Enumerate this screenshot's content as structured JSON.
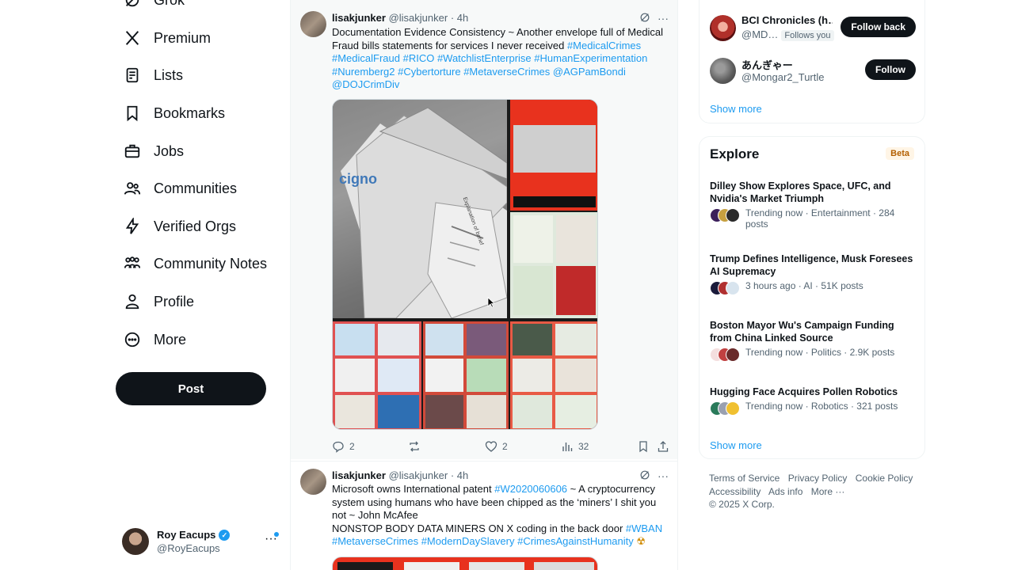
{
  "nav": {
    "items": [
      {
        "label": "Grok",
        "icon": "grok-icon"
      },
      {
        "label": "Premium",
        "icon": "x-logo-icon"
      },
      {
        "label": "Lists",
        "icon": "lists-icon"
      },
      {
        "label": "Bookmarks",
        "icon": "bookmark-icon"
      },
      {
        "label": "Jobs",
        "icon": "briefcase-icon"
      },
      {
        "label": "Communities",
        "icon": "people-icon"
      },
      {
        "label": "Verified Orgs",
        "icon": "lightning-icon"
      },
      {
        "label": "Community Notes",
        "icon": "community-notes-icon"
      },
      {
        "label": "Profile",
        "icon": "person-icon"
      },
      {
        "label": "More",
        "icon": "more-circle-icon"
      }
    ],
    "post_label": "Post"
  },
  "account": {
    "name": "Roy Eacups",
    "handle": "@RoyEacups",
    "more": "···"
  },
  "tweets": [
    {
      "name": "lisakjunker",
      "handle": "@lisakjunker",
      "time": "· 4h",
      "text_plain": "Documentation Evidence Consistency ~ Another envelope full of Medical Fraud bills statements for services I never received ",
      "text_links": "#MedicalCrimes #MedicalFraud #RICO #WatchlistEnterprise #HumanExperimentation #Nuremberg2 #Cybertorture #MetaverseCrimes @AGPamBondi @DOJCrimDiv",
      "replies": "2",
      "reposts": "",
      "likes": "2",
      "views": "32"
    },
    {
      "name": "lisakjunker",
      "handle": "@lisakjunker",
      "time": "· 4h",
      "line1_plain": "Microsoft owns International patent ",
      "line1_link": "#W2020060606",
      "line1_rest": "  ~ A cryptocurrency system using humans who have been chipped as the ‘miners’ I shit you not ~ John McAfee",
      "line2_plain": "NONSTOP BODY DATA MINERS ON  X coding in the back door  ",
      "line2_link": "#WBAN",
      "line3_links": "#MetaverseCrimes #ModernDaySlavery #CrimesAgainstHumanity",
      "emoji": "☢"
    }
  ],
  "media": {
    "brand_text": "cigno",
    "doc_heading": "Explanation of benef"
  },
  "who_to_follow": [
    {
      "name": "BCI Chronicles (h…",
      "handle": "@MD…",
      "badge": "Follows you",
      "button": "Follow back"
    },
    {
      "name": "あんぎゃー",
      "handle": "@Mongar2_Turtle",
      "badge": "",
      "button": "Follow"
    }
  ],
  "show_more_1": "Show more",
  "explore": {
    "title": "Explore",
    "badge": "Beta",
    "trends": [
      {
        "title": "Dilley Show Explores Space, UFC, and Nvidia's Market Triumph",
        "meta": "Trending now · Entertainment · 284 posts"
      },
      {
        "title": "Trump Defines Intelligence, Musk Foresees AI Supremacy",
        "meta": "3 hours ago · AI · 51K posts"
      },
      {
        "title": "Boston Mayor Wu's Campaign Funding from China Linked Source",
        "meta": "Trending now · Politics · 2.9K posts"
      },
      {
        "title": "Hugging Face Acquires Pollen Robotics",
        "meta": "Trending now · Robotics · 321 posts"
      }
    ],
    "show_more": "Show more"
  },
  "footer": {
    "links": [
      "Terms of Service",
      "Privacy Policy",
      "Cookie Policy",
      "Accessibility",
      "Ads info",
      "More ···"
    ],
    "copyright": "© 2025 X Corp."
  },
  "colors": {
    "accent": "#1d9bf0",
    "text": "#0f1419",
    "muted": "#536471",
    "button": "#0f1419",
    "media_red": "#e8321e"
  }
}
